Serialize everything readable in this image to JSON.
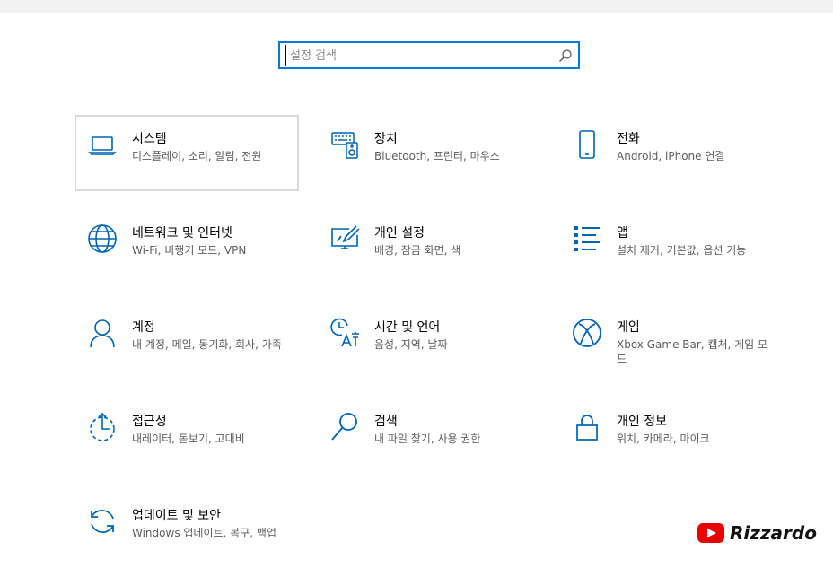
{
  "search": {
    "placeholder": "설정 검색",
    "icon": "search-icon"
  },
  "tiles": [
    {
      "title": "시스템",
      "desc": "디스플레이, 소리, 알림, 전원",
      "icon": "laptop-icon",
      "selected": true
    },
    {
      "title": "장치",
      "desc": "Bluetooth, 프린터, 마우스",
      "icon": "keyboard-speaker-icon"
    },
    {
      "title": "전화",
      "desc": "Android, iPhone 연결",
      "icon": "phone-icon"
    },
    {
      "title": "네트워크 및 인터넷",
      "desc": "Wi-Fi, 비행기 모드, VPN",
      "icon": "globe-icon"
    },
    {
      "title": "개인 설정",
      "desc": "배경, 잠금 화면, 색",
      "icon": "paint-monitor-icon"
    },
    {
      "title": "앱",
      "desc": "설치 제거, 기본값, 옵션 기능",
      "icon": "apps-list-icon"
    },
    {
      "title": "계정",
      "desc": "내 계정, 메일, 동기화, 회사, 가족",
      "icon": "person-icon"
    },
    {
      "title": "시간 및 언어",
      "desc": "음성, 지역, 날짜",
      "icon": "time-language-icon"
    },
    {
      "title": "게임",
      "desc": "Xbox Game Bar, 캡처, 게임 모드",
      "icon": "xbox-icon"
    },
    {
      "title": "접근성",
      "desc": "내레이터, 돋보기, 고대비",
      "icon": "ease-of-access-icon"
    },
    {
      "title": "검색",
      "desc": "내 파일 찾기, 사용 권한",
      "icon": "magnifier-icon"
    },
    {
      "title": "개인 정보",
      "desc": "위치, 카메라, 마이크",
      "icon": "lock-icon"
    },
    {
      "title": "업데이트 및 보안",
      "desc": "Windows 업데이트, 복구, 백업",
      "icon": "sync-icon"
    }
  ],
  "brand": {
    "name": "Rizzardo",
    "logo": "youtube-logo-icon"
  },
  "colors": {
    "accent": "#0078d7",
    "icon": "#0063b1",
    "selected_border": "#d9d9d9",
    "desc_text": "#5d5d5d",
    "brand_red": "#e60000"
  }
}
